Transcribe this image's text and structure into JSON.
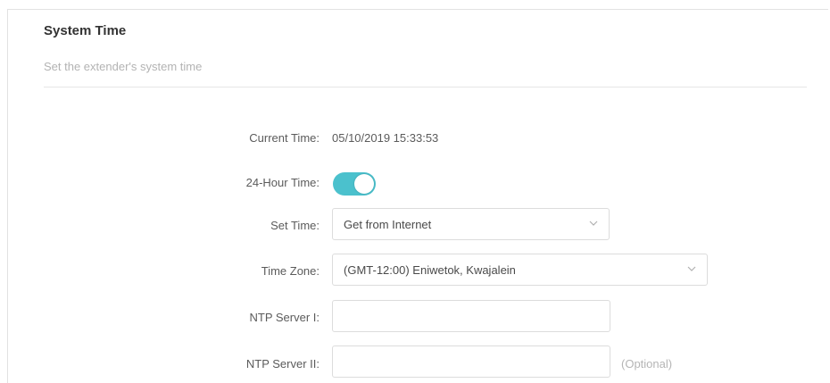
{
  "page": {
    "title": "System Time",
    "subtitle": "Set the extender's system time"
  },
  "form": {
    "current_time_label": "Current Time:",
    "current_time_value": "05/10/2019 15:33:53",
    "hour24_label": "24-Hour Time:",
    "hour24_enabled": true,
    "set_time_label": "Set Time:",
    "set_time_value": "Get from Internet",
    "time_zone_label": "Time Zone:",
    "time_zone_value": "(GMT-12:00) Eniwetok, Kwajalein",
    "ntp1_label": "NTP Server I:",
    "ntp1_value": "",
    "ntp2_label": "NTP Server II:",
    "ntp2_value": "",
    "optional_text": "(Optional)"
  },
  "colors": {
    "toggle_on": "#4bc1cd"
  }
}
